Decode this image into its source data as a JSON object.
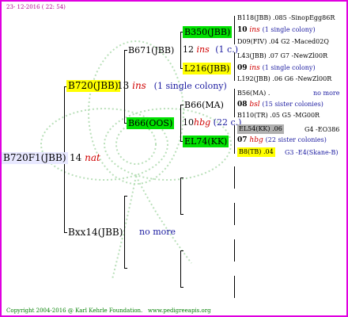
{
  "header": {
    "date": "23- 12-2016 ( 22: 54)"
  },
  "footer": {
    "copyright": "Copyright 2004-2016 @ Karl Kehrle Foundation.",
    "url": "www.pedigreeapis.org"
  },
  "root": {
    "name": "B720F1(JBB)",
    "gen": "14",
    "tag": "nat"
  },
  "gen1": {
    "top": {
      "name": "B720(JBB)",
      "gen": "13",
      "tag": "ins",
      "note": "(1 single colony)"
    },
    "bottom": {
      "name": "Bxx14(JBB)",
      "note": "no more"
    }
  },
  "gen2": {
    "a": {
      "name": "B671(JBB)",
      "gen": "12",
      "tag": "ins",
      "note": "(1 c.)"
    },
    "b": {
      "name": "B66(OOS)",
      "gen": "10",
      "tag": "hbg",
      "note": "(22 c.)"
    }
  },
  "gen3": {
    "a": "B350(JBB)",
    "b": "L216(JBB)",
    "c": "B66(MA)",
    "d": "EL74(KK)"
  },
  "gen4": [
    {
      "line1": "B118(JBB) .085 -SinopEgg86R",
      "gen": "10",
      "tag": "ins",
      "note": "(1 single colony)",
      "line3": "D09(FIV) .04   G2 -Maced02Q"
    },
    {
      "line1": "L43(JBB) .07    G7 -NewZl00R",
      "gen": "09",
      "tag": "ins",
      "note": "(1 single colony)",
      "line3": "L192(JBB) .06   G6 -NewZl00R"
    },
    {
      "line1": "B56(MA) .",
      "line1b": "no more",
      "gen": "08",
      "tag": "bsl",
      "note": "(15 sister colonies)",
      "line3": "B110(TR) .05       G5 -MG00R"
    },
    {
      "line1": "EL54(KK) .06",
      "line1b": "G4 -EO386",
      "gen": "07",
      "tag": "hbg",
      "note": "(22 sister colonies)",
      "line3a": "B8(TB) .04",
      "line3b": "G3 -E4(Skane-B)"
    }
  ]
}
